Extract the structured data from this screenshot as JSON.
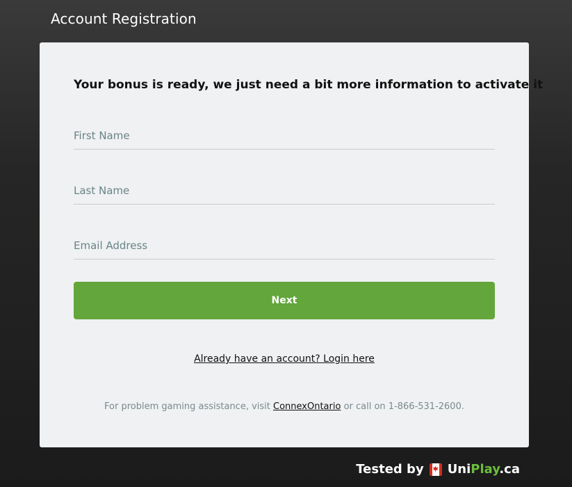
{
  "header": {
    "title": "Account Registration"
  },
  "form": {
    "headline": "Your bonus is ready, we just need a bit more information to activate it",
    "first_name": {
      "placeholder": "First Name",
      "value": ""
    },
    "last_name": {
      "placeholder": "Last Name",
      "value": ""
    },
    "email": {
      "placeholder": "Email Address",
      "value": ""
    },
    "next_label": "Next",
    "login_link": "Already have an account? Login here"
  },
  "footer": {
    "prefix": "For problem gaming assistance, visit ",
    "link": "ConnexOntario",
    "suffix": " or call on 1-866-531-2600."
  },
  "watermark": {
    "tested_by": "Tested by",
    "brand_part1": "Uni",
    "brand_part2": "Play",
    "brand_part3": ".ca"
  },
  "colors": {
    "accent": "#63a63b",
    "card_bg": "#eff1f2",
    "page_bg": "#262626"
  }
}
